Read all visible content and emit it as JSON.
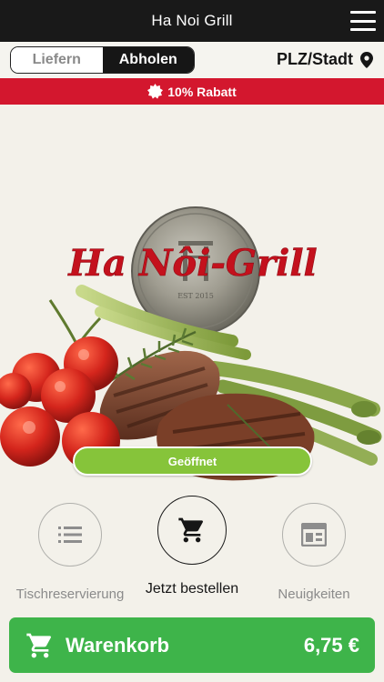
{
  "header": {
    "title": "Ha Noi Grill"
  },
  "mode": {
    "options": [
      "Liefern",
      "Abholen"
    ],
    "selected": "Abholen",
    "location_label": "PLZ/Stadt"
  },
  "discount": {
    "text": "10% Rabatt",
    "color": "#d3172e"
  },
  "hero": {
    "logo_text": "Ha Nôi-Grill",
    "status_button": "Geöffnet",
    "status_color": "#86c43a"
  },
  "actions": [
    {
      "label": "Tischreservierung",
      "icon": "list-icon",
      "active": false
    },
    {
      "label": "Jetzt bestellen",
      "icon": "cart-icon",
      "active": true
    },
    {
      "label": "Neuigkeiten",
      "icon": "news-icon",
      "active": false
    }
  ],
  "cart": {
    "label": "Warenkorb",
    "total": "6,75 €",
    "color": "#3eb44a"
  }
}
